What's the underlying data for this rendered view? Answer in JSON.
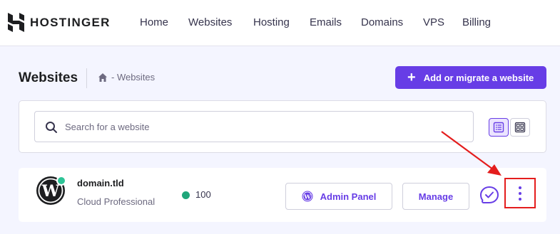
{
  "brand": {
    "name": "HOSTINGER"
  },
  "nav": [
    {
      "label": "Home"
    },
    {
      "label": "Websites"
    },
    {
      "label": "Hosting"
    },
    {
      "label": "Emails"
    },
    {
      "label": "Domains"
    },
    {
      "label": "VPS"
    },
    {
      "label": "Billing"
    }
  ],
  "header": {
    "title": "Websites",
    "breadcrumb": "- Websites",
    "add_button_label": "Add or migrate a website"
  },
  "search": {
    "placeholder": "Search for a website",
    "value": ""
  },
  "view_toggle": {
    "active": "list"
  },
  "website": {
    "domain": "domain.tld",
    "plan": "Cloud Professional",
    "score": "100",
    "admin_panel_label": "Admin Panel",
    "manage_label": "Manage"
  },
  "icons": {
    "home": "home-icon",
    "search": "search-icon",
    "list_view": "list-view-icon",
    "grid_view": "grid-view-icon",
    "wordpress": "wordpress-icon",
    "support": "chat-check-icon",
    "more": "more-vertical-icon"
  },
  "colors": {
    "accent": "#673de6",
    "success": "#1fa67a",
    "highlight": "#e41d1d",
    "background": "#f4f5ff"
  }
}
